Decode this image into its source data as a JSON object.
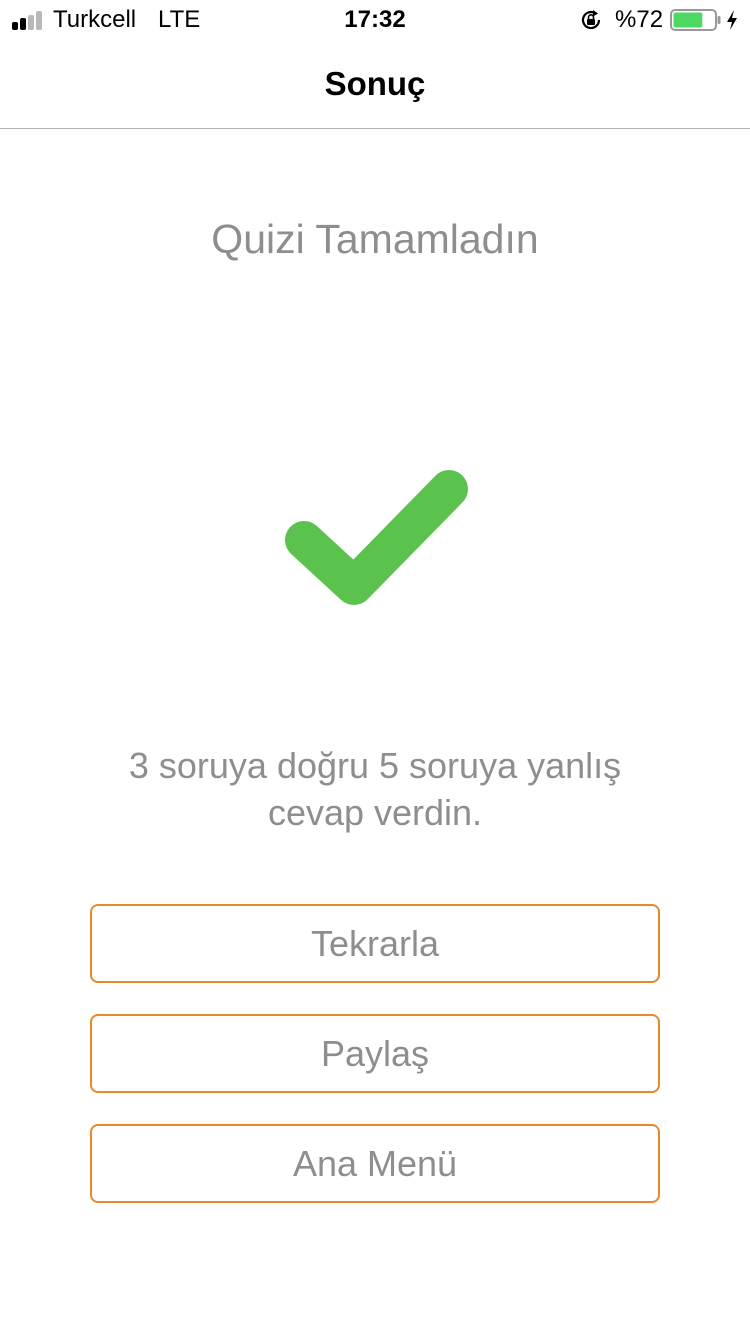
{
  "status_bar": {
    "carrier": "Turkcell",
    "network": "LTE",
    "time": "17:32",
    "battery_percent": "%72",
    "battery_level": 0.72,
    "signal_bars_filled": 2,
    "signal_bars_total": 4,
    "icons": [
      "signal-icon",
      "orientation-lock-icon",
      "battery-icon",
      "charging-icon"
    ]
  },
  "nav": {
    "title": "Sonuç"
  },
  "main": {
    "heading": "Quizi Tamamladın",
    "result_line1": "3 soruya doğru 5 soruya yanlış",
    "result_line2": "cevap verdin.",
    "result_icon": "checkmark-icon"
  },
  "buttons": {
    "retry": "Tekrarla",
    "share": "Paylaş",
    "main_menu": "Ana Menü"
  },
  "colors": {
    "checkmark": "#5cc24e",
    "button_border": "#e8892c",
    "text_gray": "#8e8e8e",
    "battery_fill": "#4cd964"
  }
}
